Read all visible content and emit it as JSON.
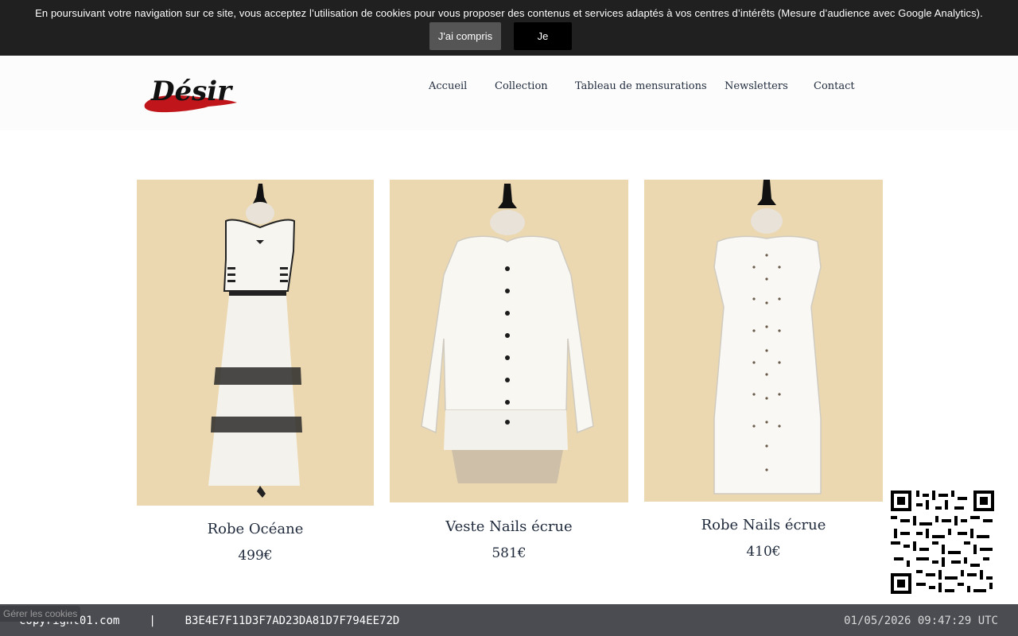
{
  "cookie_banner": {
    "message": "En poursuivant votre navigation sur ce site, vous acceptez l’utilisation de cookies pour vous proposer des contenus et services adaptés à vos centres d’intérêts (Mesure d’audience avec Google Analytics).",
    "accept_label": "J'ai compris",
    "refuse_label": "Je refuse"
  },
  "header": {
    "logo_text": "Désir",
    "nav": [
      "Accueil",
      "Collection",
      "Tableau de mensurations",
      "Newsletters",
      "Contact"
    ]
  },
  "products": [
    {
      "name": "Robe Océane",
      "price": "499€"
    },
    {
      "name": "Veste Nails écrue",
      "price": "581€"
    },
    {
      "name": "Robe Nails écrue",
      "price": "410€"
    }
  ],
  "manage_cookies_label": "Gérer les cookies",
  "footer": {
    "copyright": "copyright01.com",
    "separator": "|",
    "hash": "B3E4E7F11D3F7AD23DA81D7F794EE72D",
    "timestamp": "01/05/2026 09:47:29 UTC"
  },
  "colors": {
    "product_background": "#ebd8b0",
    "logo_red": "#c0161b",
    "banner_background": "#202020",
    "footer_background": "#4a4c52"
  }
}
